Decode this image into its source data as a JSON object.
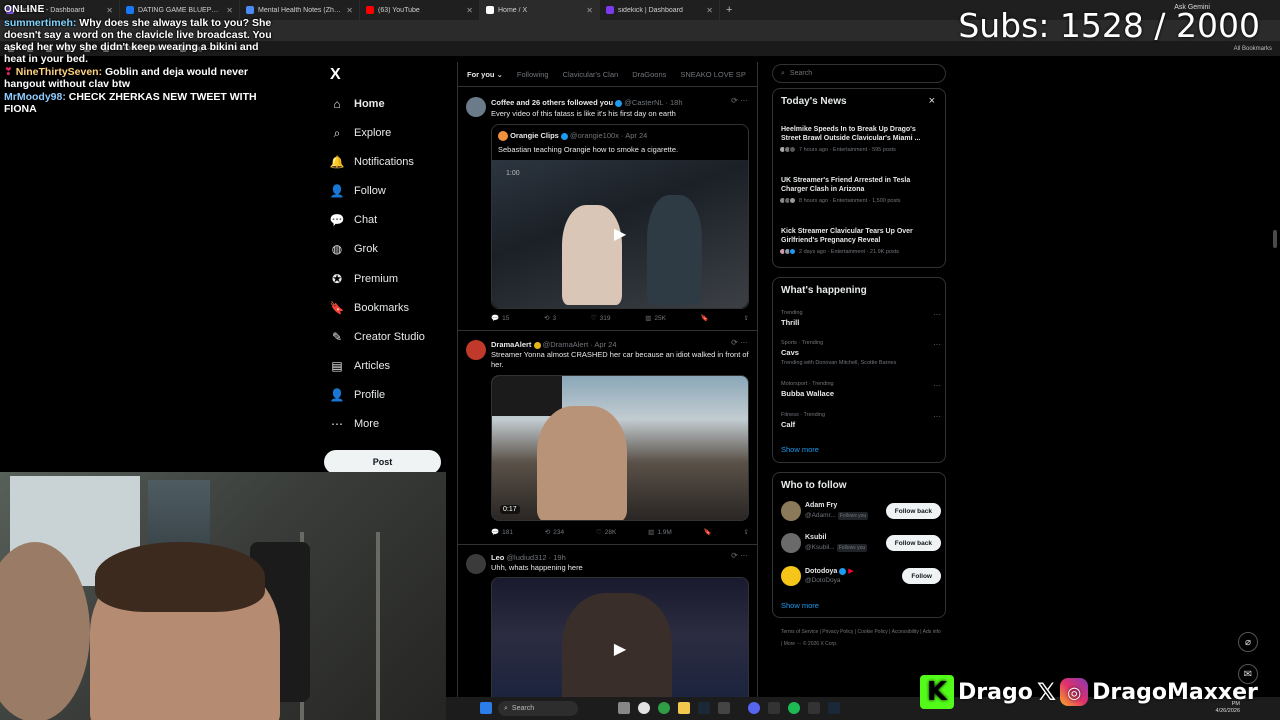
{
  "browser": {
    "tabs": [
      {
        "label": "Sidekick - Dashboard",
        "color": "#8b5cf6",
        "active": false
      },
      {
        "label": "DATING GAME BLUEPRINT (Ben",
        "color": "#1877f2",
        "active": false
      },
      {
        "label": "Mental Health Notes (Zherka a",
        "color": "#4c8bf5",
        "active": false
      },
      {
        "label": "(63) YouTube",
        "color": "#ff0000",
        "active": false
      },
      {
        "label": "Home / X",
        "color": "#ffffff",
        "active": true
      },
      {
        "label": "sidekick | Dashboard",
        "color": "#7c3aed",
        "active": false
      }
    ],
    "new_tab": "+",
    "bookmarks": [
      "",
      "",
      "",
      "",
      "",
      "IRLToolkit » Dashbo...",
      "Drago – Exclusive S..."
    ],
    "all_bookmarks": "All Bookmarks",
    "ask_gemini": "Ask Gemini"
  },
  "overlay": {
    "subs": "Subs: 1528 / 2000",
    "chat": {
      "status": "ONLINE",
      "messages": [
        {
          "user": "summertimeh:",
          "text": "Why does she always talk to you? She doesn't say a word on the clavicle live broadcast. You asked her why she didn't keep wearing a bikini and heat in your bed."
        },
        {
          "user": "NineThirtySeven:",
          "text": "Goblin and deja would never hangout without clav btw"
        },
        {
          "user": "MrMoody98:",
          "text": "CHECK ZHERKAS NEW TWEET WITH FIONA"
        }
      ]
    },
    "social": {
      "kick": "Drago",
      "ig": "DragoMaxxer"
    }
  },
  "nav": {
    "logo": "X",
    "items": [
      {
        "label": "Home",
        "icon": "⌂"
      },
      {
        "label": "Explore",
        "icon": "⌕"
      },
      {
        "label": "Notifications",
        "icon": "🔔"
      },
      {
        "label": "Follow",
        "icon": "👤"
      },
      {
        "label": "Chat",
        "icon": "💬"
      },
      {
        "label": "Grok",
        "icon": "◍"
      },
      {
        "label": "Premium",
        "icon": "✪"
      },
      {
        "label": "Bookmarks",
        "icon": "🔖"
      },
      {
        "label": "Creator Studio",
        "icon": "✎"
      },
      {
        "label": "Articles",
        "icon": "▤"
      },
      {
        "label": "Profile",
        "icon": "👤"
      },
      {
        "label": "More",
        "icon": "⋯"
      }
    ],
    "post": "Post"
  },
  "feed": {
    "tabs": [
      "For you",
      "Following",
      "Clavicular's Clan",
      "DraGoons",
      "SNEAKO LOVE SP"
    ],
    "tweets": [
      {
        "context": "Coffee and 26 others followed you",
        "handle": "@CasterNL",
        "time": "· 18h",
        "text": "Every video of this fatass is like it's his first day on earth",
        "quote_name": "Orangie Clips",
        "quote_handle": "@orangie100x · Apr 24",
        "quote_text": "Sebastian teaching Orangie how to smoke a cigarette.",
        "quote_timestamp": "1:00",
        "actions": [
          "15",
          "3",
          "319",
          "25K",
          "",
          ""
        ]
      },
      {
        "name": "DramaAlert",
        "handle": "@DramaAlert · Apr 24",
        "text": "Streamer Yonna almost CRASHED her car because an idiot walked in front of her.",
        "duration": "0:17",
        "actions": [
          "181",
          "234",
          "28K",
          "1.9M",
          "",
          ""
        ]
      },
      {
        "name": "Leo",
        "handle": "@ludiud312 · 19h",
        "text": "Uhh, whats happening here"
      }
    ]
  },
  "sidebar": {
    "search_placeholder": "Search",
    "news": {
      "title": "Today's News",
      "close": "×",
      "items": [
        {
          "title": "Heelmike Speeds In to Break Up Drago's Street Brawl Outside Clavicular's Miami ...",
          "meta": "7 hours ago · Entertainment · 595 posts"
        },
        {
          "title": "UK Streamer's Friend Arrested in Tesla Charger Clash in Arizona",
          "meta": "8 hours ago · Entertainment · 1,500 posts"
        },
        {
          "title": "Kick Streamer Clavicular Tears Up Over Girlfriend's Pregnancy Reveal",
          "meta": "2 days ago · Entertainment · 21.9K posts"
        }
      ]
    },
    "happening": {
      "title": "What's happening",
      "items": [
        {
          "meta": "Trending",
          "name": "Thrill",
          "extra": ""
        },
        {
          "meta": "Sports · Trending",
          "name": "Cavs",
          "extra": "Trending with Donovan Mitchell, Scottie Barnes"
        },
        {
          "meta": "Motorsport · Trending",
          "name": "Bubba Wallace",
          "extra": ""
        },
        {
          "meta": "Fitness · Trending",
          "name": "Calf",
          "extra": ""
        }
      ],
      "show_more": "Show more"
    },
    "who_to_follow": {
      "title": "Who to follow",
      "items": [
        {
          "name": "Adam Fry",
          "handle": "@Adamr...",
          "follows_you": "Follows you",
          "button": "Follow back"
        },
        {
          "name": "Ksubil",
          "handle": "@Ksubil...",
          "follows_you": "Follows you",
          "button": "Follow back"
        },
        {
          "name": "Dotodoya",
          "handle": "@DotoDoya",
          "follows_you": "",
          "button": "Follow"
        }
      ],
      "show_more": "Show more"
    },
    "footer": "Terms of Service | Privacy Policy | Cookie Policy | Accessibility | Ads info | More ··· © 2026 X Corp."
  },
  "taskbar": {
    "search": "Search",
    "time": "PM",
    "date": "4/26/2026"
  }
}
